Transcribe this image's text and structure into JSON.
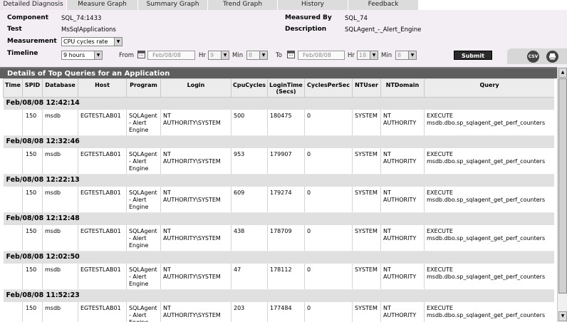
{
  "tabs": [
    {
      "label": "Detailed Diagnosis",
      "active": true
    },
    {
      "label": "Measure Graph",
      "active": false
    },
    {
      "label": "Summary Graph",
      "active": false
    },
    {
      "label": "Trend Graph",
      "active": false
    },
    {
      "label": "History",
      "active": false
    },
    {
      "label": "Feedback",
      "active": false
    }
  ],
  "header": {
    "component_label": "Component",
    "component_value": "SQL_74:1433",
    "test_label": "Test",
    "test_value": "MsSqlApplications",
    "measurement_label": "Measurement",
    "measurement_value": "CPU cycles rate",
    "timeline_label": "Timeline",
    "timeline_value": "9 hours",
    "measured_by_label": "Measured By",
    "measured_by_value": "SQL_74",
    "description_label": "Description",
    "description_value": "SQLAgent_-_Alert_Engine",
    "from_label": "From",
    "from_date": "Feb/08/08",
    "from_hr_label": "Hr",
    "from_hr": "9",
    "from_min_label": "Min",
    "from_min": "8",
    "to_label": "To",
    "to_date": "Feb/08/08",
    "to_hr_label": "Hr",
    "to_hr": "18",
    "to_min_label": "Min",
    "to_min": "8",
    "submit_label": "Submit",
    "csv_label": "CSV"
  },
  "table": {
    "title": "Details of Top Queries for an Application",
    "columns": [
      "Time",
      "SPID",
      "Database",
      "Host",
      "Program",
      "Login",
      "CpuCycles",
      "LoginTime (Secs)",
      "CyclesPerSec",
      "NTUser",
      "NTDomain",
      "Query"
    ],
    "groups": [
      {
        "time": "Feb/08/08 12:42:14",
        "row": {
          "spid": "150",
          "database": "msdb",
          "host": "EGTESTLAB01",
          "program": "SQLAgent - Alert Engine",
          "login": "NT AUTHORITY\\SYSTEM",
          "cpu": "500",
          "logintime": "180475",
          "cps": "0",
          "ntuser": "SYSTEM",
          "ntdomain": "NT AUTHORITY",
          "query": "EXECUTE msdb.dbo.sp_sqlagent_get_perf_counters"
        }
      },
      {
        "time": "Feb/08/08 12:32:46",
        "row": {
          "spid": "150",
          "database": "msdb",
          "host": "EGTESTLAB01",
          "program": "SQLAgent - Alert Engine",
          "login": "NT AUTHORITY\\SYSTEM",
          "cpu": "953",
          "logintime": "179907",
          "cps": "0",
          "ntuser": "SYSTEM",
          "ntdomain": "NT AUTHORITY",
          "query": "EXECUTE msdb.dbo.sp_sqlagent_get_perf_counters"
        }
      },
      {
        "time": "Feb/08/08 12:22:13",
        "row": {
          "spid": "150",
          "database": "msdb",
          "host": "EGTESTLAB01",
          "program": "SQLAgent - Alert Engine",
          "login": "NT AUTHORITY\\SYSTEM",
          "cpu": "609",
          "logintime": "179274",
          "cps": "0",
          "ntuser": "SYSTEM",
          "ntdomain": "NT AUTHORITY",
          "query": "EXECUTE msdb.dbo.sp_sqlagent_get_perf_counters"
        }
      },
      {
        "time": "Feb/08/08 12:12:48",
        "row": {
          "spid": "150",
          "database": "msdb",
          "host": "EGTESTLAB01",
          "program": "SQLAgent - Alert Engine",
          "login": "NT AUTHORITY\\SYSTEM",
          "cpu": "438",
          "logintime": "178709",
          "cps": "0",
          "ntuser": "SYSTEM",
          "ntdomain": "NT AUTHORITY",
          "query": "EXECUTE msdb.dbo.sp_sqlagent_get_perf_counters"
        }
      },
      {
        "time": "Feb/08/08 12:02:50",
        "row": {
          "spid": "150",
          "database": "msdb",
          "host": "EGTESTLAB01",
          "program": "SQLAgent - Alert Engine",
          "login": "NT AUTHORITY\\SYSTEM",
          "cpu": "47",
          "logintime": "178112",
          "cps": "0",
          "ntuser": "SYSTEM",
          "ntdomain": "NT AUTHORITY",
          "query": "EXECUTE msdb.dbo.sp_sqlagent_get_perf_counters"
        }
      },
      {
        "time": "Feb/08/08 11:52:23",
        "row": {
          "spid": "150",
          "database": "msdb",
          "host": "EGTESTLAB01",
          "program": "SQLAgent - Alert Engine",
          "login": "NT AUTHORITY\\SYSTEM",
          "cpu": "203",
          "logintime": "177484",
          "cps": "0",
          "ntuser": "SYSTEM",
          "ntdomain": "NT AUTHORITY",
          "query": "EXECUTE msdb.dbo.sp_sqlagent_get_perf_counters"
        }
      }
    ]
  },
  "colors": {
    "header_bg": "#f3eef3",
    "title_bar": "#5e5e5e",
    "group_row": "#e0e0e0"
  }
}
